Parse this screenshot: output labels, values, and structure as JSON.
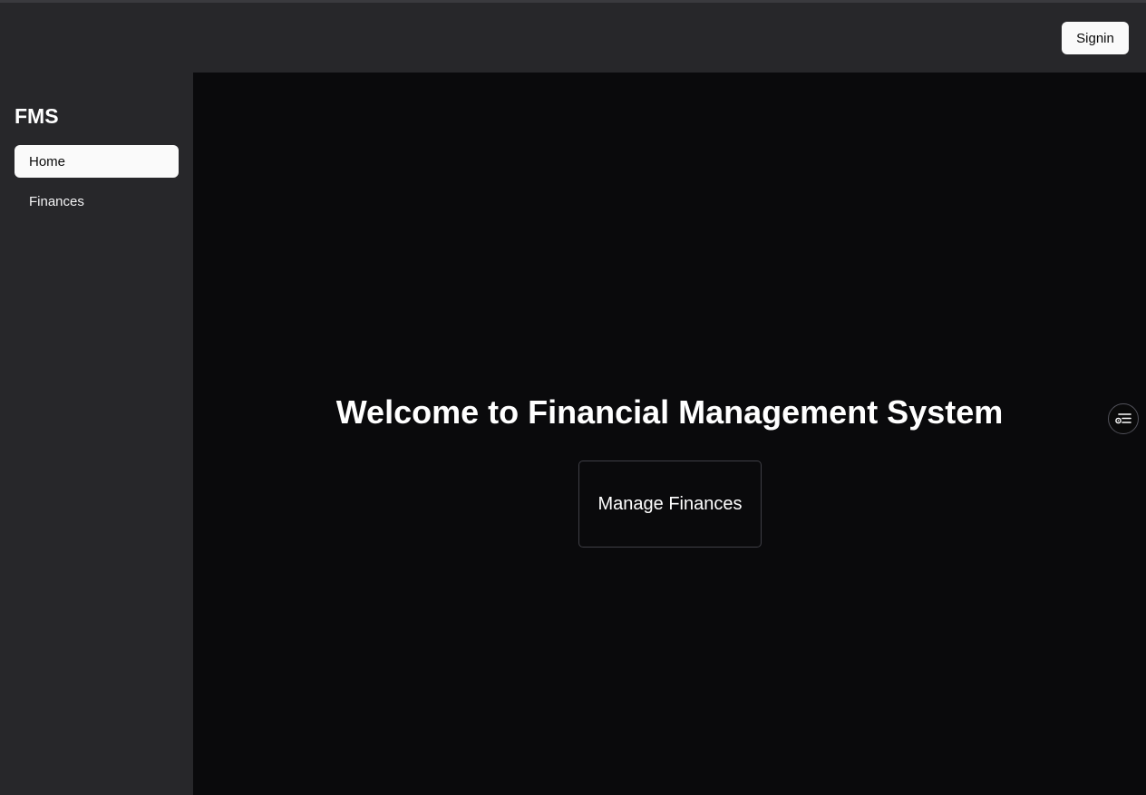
{
  "header": {
    "signin_label": "Signin"
  },
  "sidebar": {
    "brand": "FMS",
    "items": [
      {
        "label": "Home",
        "active": true
      },
      {
        "label": "Finances",
        "active": false
      }
    ]
  },
  "main": {
    "heading": "Welcome to Financial Management System",
    "cta_label": "Manage Finances"
  },
  "floating_button": {
    "icon": "list-settings-icon"
  },
  "colors": {
    "sidebar_bg": "#27272a",
    "main_bg": "#0a0a0c",
    "active_item_bg": "#fafafa"
  }
}
